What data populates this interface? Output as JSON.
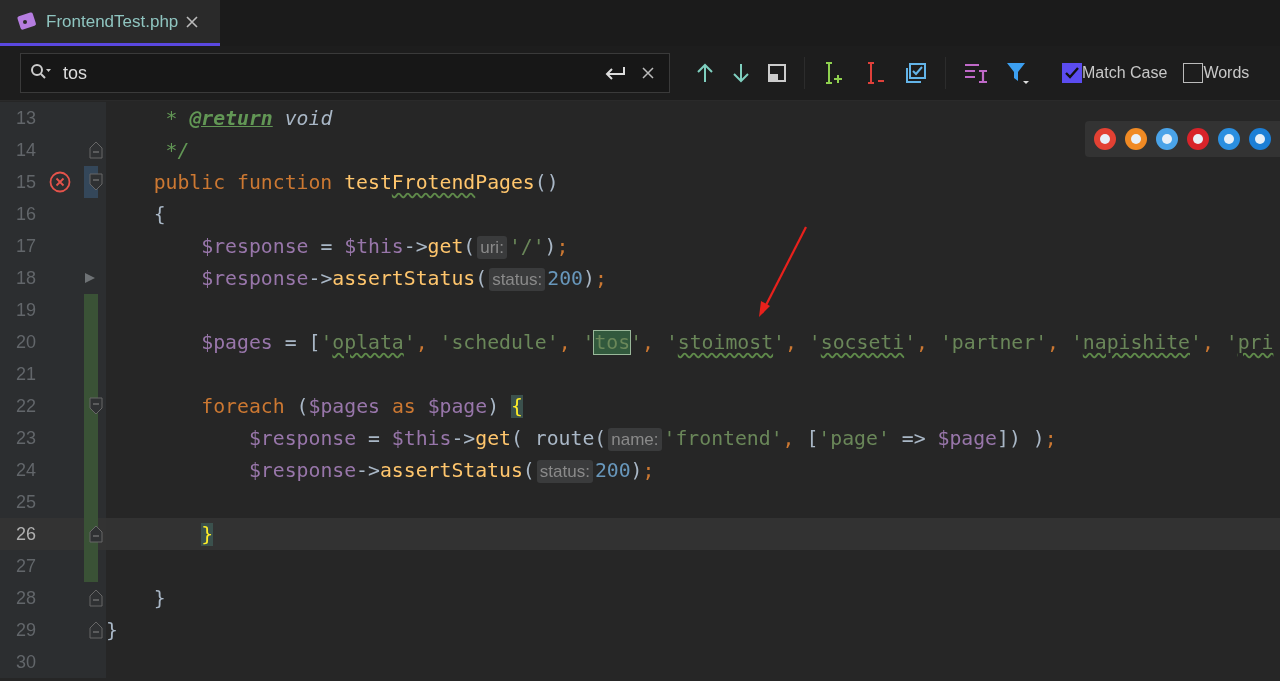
{
  "tab": {
    "title": "FrontendTest.php",
    "selected": true
  },
  "search": {
    "value": "tos"
  },
  "options": [
    {
      "label": "Match Case",
      "checked": true
    },
    {
      "label": "Words",
      "checked": false
    }
  ],
  "lines": [
    {
      "number": "13",
      "current": false,
      "added": false,
      "modified": false,
      "fold_open": false,
      "fold_close": false,
      "error": false,
      "run": false,
      "tokens": [
        {
          "t": "     * ",
          "kind": "doc"
        },
        {
          "t": "@return",
          "kind": "doctag"
        },
        {
          "t": " void",
          "kind": "docword"
        }
      ]
    },
    {
      "number": "14",
      "current": false,
      "added": false,
      "modified": false,
      "fold_open": false,
      "fold_close": true,
      "error": false,
      "run": false,
      "tokens": [
        {
          "t": "     */",
          "kind": "doc"
        }
      ]
    },
    {
      "number": "15",
      "current": false,
      "added": false,
      "modified": true,
      "fold_open": true,
      "fold_close": false,
      "error": true,
      "run": false,
      "tokens": [
        {
          "t": "    public function ",
          "kind": "kw"
        },
        {
          "t": "test",
          "kind": "fn"
        },
        {
          "t": "Frotend",
          "kind": "fntypo"
        },
        {
          "t": "Pages",
          "kind": "fn"
        },
        {
          "t": "()",
          "kind": "op"
        }
      ]
    },
    {
      "number": "16",
      "current": false,
      "added": false,
      "modified": false,
      "fold_open": false,
      "fold_close": false,
      "error": false,
      "run": false,
      "tokens": [
        {
          "t": "    {",
          "kind": "op"
        }
      ]
    },
    {
      "number": "17",
      "current": false,
      "added": false,
      "modified": false,
      "fold_open": false,
      "fold_close": false,
      "error": false,
      "run": false,
      "tokens": [
        {
          "t": "        $response",
          "kind": "var"
        },
        {
          "t": " = ",
          "kind": "op"
        },
        {
          "t": "$this",
          "kind": "var"
        },
        {
          "t": "->",
          "kind": "op"
        },
        {
          "t": "get",
          "kind": "fn"
        },
        {
          "t": "(",
          "kind": "op"
        },
        {
          "t": "uri:",
          "kind": "hint"
        },
        {
          "t": "'/'",
          "kind": "str"
        },
        {
          "t": ")",
          "kind": "op"
        },
        {
          "t": ";",
          "kind": "semi"
        }
      ]
    },
    {
      "number": "18",
      "current": false,
      "added": false,
      "modified": false,
      "fold_open": false,
      "fold_close": false,
      "error": false,
      "run": true,
      "tokens": [
        {
          "t": "        $response",
          "kind": "var"
        },
        {
          "t": "->",
          "kind": "op"
        },
        {
          "t": "assertStatus",
          "kind": "fn"
        },
        {
          "t": "(",
          "kind": "op"
        },
        {
          "t": "status:",
          "kind": "hint"
        },
        {
          "t": "200",
          "kind": "num"
        },
        {
          "t": ")",
          "kind": "op"
        },
        {
          "t": ";",
          "kind": "semi"
        }
      ]
    },
    {
      "number": "19",
      "current": false,
      "added": true,
      "modified": false,
      "fold_open": false,
      "fold_close": false,
      "error": false,
      "run": false
    },
    {
      "number": "20",
      "current": false,
      "added": true,
      "modified": false,
      "fold_open": false,
      "fold_close": false,
      "error": false,
      "run": false,
      "tokens": [
        {
          "t": "        $pages",
          "kind": "var"
        },
        {
          "t": " = [",
          "kind": "op"
        },
        {
          "t": "'",
          "kind": "str"
        },
        {
          "t": "oplata",
          "kind": "strtypo"
        },
        {
          "t": "'",
          "kind": "str"
        },
        {
          "t": ", ",
          "kind": "semi"
        },
        {
          "t": "'schedule'",
          "kind": "str"
        },
        {
          "t": ", ",
          "kind": "semi"
        },
        {
          "t": "'",
          "kind": "str"
        },
        {
          "t": "tos",
          "kind": "match"
        },
        {
          "t": "'",
          "kind": "str"
        },
        {
          "t": ", ",
          "kind": "semi"
        },
        {
          "t": "'",
          "kind": "str"
        },
        {
          "t": "stoimost",
          "kind": "strtypo"
        },
        {
          "t": "'",
          "kind": "str"
        },
        {
          "t": ", ",
          "kind": "semi"
        },
        {
          "t": "'",
          "kind": "str"
        },
        {
          "t": "socseti",
          "kind": "strtypo"
        },
        {
          "t": "'",
          "kind": "str"
        },
        {
          "t": ", ",
          "kind": "semi"
        },
        {
          "t": "'partner'",
          "kind": "str"
        },
        {
          "t": ", ",
          "kind": "semi"
        },
        {
          "t": "'",
          "kind": "str"
        },
        {
          "t": "napishite",
          "kind": "strtypo"
        },
        {
          "t": "'",
          "kind": "str"
        },
        {
          "t": ", ",
          "kind": "semi"
        },
        {
          "t": "'",
          "kind": "str"
        },
        {
          "t": "pri",
          "kind": "strtypo"
        }
      ]
    },
    {
      "number": "21",
      "current": false,
      "added": true,
      "modified": false,
      "fold_open": false,
      "fold_close": false,
      "error": false,
      "run": false
    },
    {
      "number": "22",
      "current": false,
      "added": true,
      "modified": false,
      "fold_open": true,
      "fold_close": false,
      "error": false,
      "run": false,
      "tokens": [
        {
          "t": "        foreach",
          "kind": "kw"
        },
        {
          "t": " (",
          "kind": "op"
        },
        {
          "t": "$pages",
          "kind": "var"
        },
        {
          "t": " as ",
          "kind": "kw"
        },
        {
          "t": "$page",
          "kind": "var"
        },
        {
          "t": ") ",
          "kind": "op"
        },
        {
          "t": "{",
          "kind": "brace"
        }
      ]
    },
    {
      "number": "23",
      "current": false,
      "added": true,
      "modified": false,
      "fold_open": false,
      "fold_close": false,
      "error": false,
      "run": false,
      "tokens": [
        {
          "t": "            $response",
          "kind": "var"
        },
        {
          "t": " = ",
          "kind": "op"
        },
        {
          "t": "$this",
          "kind": "var"
        },
        {
          "t": "->",
          "kind": "op"
        },
        {
          "t": "get",
          "kind": "fn"
        },
        {
          "t": "( route(",
          "kind": "op"
        },
        {
          "t": "name:",
          "kind": "hint"
        },
        {
          "t": "'frontend'",
          "kind": "str"
        },
        {
          "t": ", ",
          "kind": "semi"
        },
        {
          "t": "[",
          "kind": "op"
        },
        {
          "t": "'page'",
          "kind": "str"
        },
        {
          "t": " => ",
          "kind": "op"
        },
        {
          "t": "$page",
          "kind": "var"
        },
        {
          "t": "]) )",
          "kind": "op"
        },
        {
          "t": ";",
          "kind": "semi"
        }
      ]
    },
    {
      "number": "24",
      "current": false,
      "added": true,
      "modified": false,
      "fold_open": false,
      "fold_close": false,
      "error": false,
      "run": false,
      "tokens": [
        {
          "t": "            $response",
          "kind": "var"
        },
        {
          "t": "->",
          "kind": "op"
        },
        {
          "t": "assertStatus",
          "kind": "fn"
        },
        {
          "t": "(",
          "kind": "op"
        },
        {
          "t": "status:",
          "kind": "hint"
        },
        {
          "t": "200",
          "kind": "num"
        },
        {
          "t": ")",
          "kind": "op"
        },
        {
          "t": ";",
          "kind": "semi"
        }
      ]
    },
    {
      "number": "25",
      "current": false,
      "added": true,
      "modified": false,
      "fold_open": false,
      "fold_close": false,
      "error": false,
      "run": false
    },
    {
      "number": "26",
      "current": true,
      "added": true,
      "modified": false,
      "fold_open": false,
      "fold_close": true,
      "error": false,
      "run": false,
      "tokens": [
        {
          "t": "        }",
          "kind": "brace"
        }
      ]
    },
    {
      "number": "27",
      "current": false,
      "added": true,
      "modified": false,
      "fold_open": false,
      "fold_close": false,
      "error": false,
      "run": false
    },
    {
      "number": "28",
      "current": false,
      "added": false,
      "modified": false,
      "fold_open": false,
      "fold_close": true,
      "error": false,
      "run": false,
      "tokens": [
        {
          "t": "    }",
          "kind": "op"
        }
      ]
    },
    {
      "number": "29",
      "current": false,
      "added": false,
      "modified": false,
      "fold_open": false,
      "fold_close": true,
      "error": false,
      "run": false,
      "tokens": [
        {
          "t": "}",
          "kind": "op"
        }
      ]
    },
    {
      "number": "30",
      "current": false,
      "added": false,
      "modified": false,
      "fold_open": false,
      "fold_close": false,
      "error": false,
      "run": false
    }
  ]
}
